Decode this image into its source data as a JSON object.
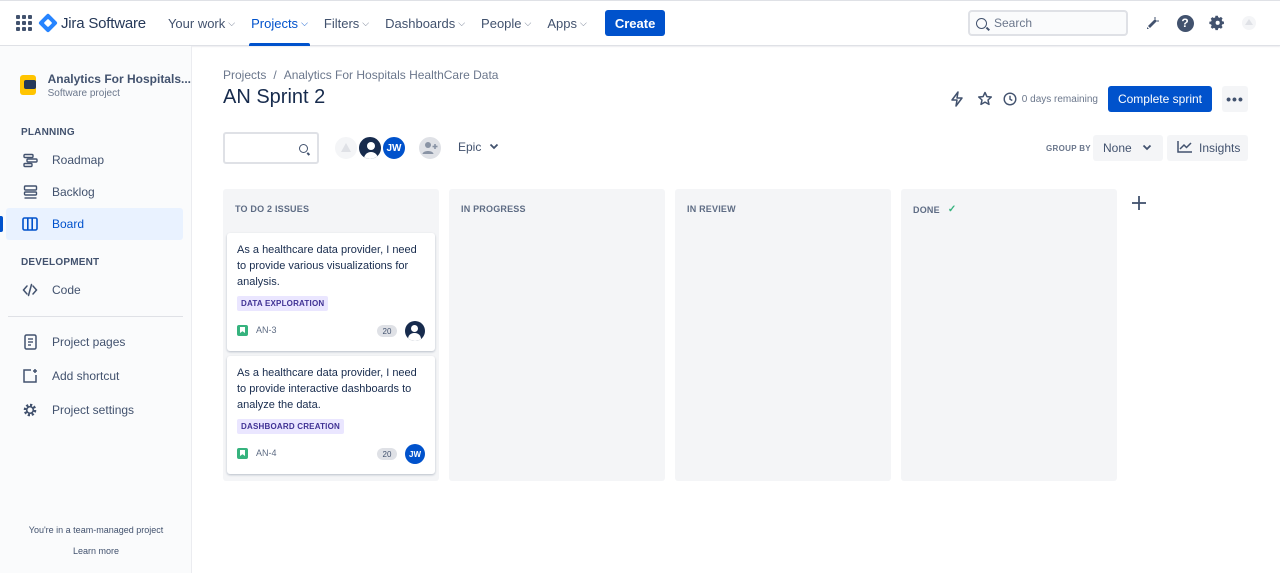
{
  "topnav": {
    "product_name": "Jira Software",
    "items": [
      {
        "label": "Your work",
        "active": false
      },
      {
        "label": "Projects",
        "active": true
      },
      {
        "label": "Filters",
        "active": false
      },
      {
        "label": "Dashboards",
        "active": false
      },
      {
        "label": "People",
        "active": false
      },
      {
        "label": "Apps",
        "active": false
      }
    ],
    "create_label": "Create",
    "search_placeholder": "Search"
  },
  "sidebar": {
    "project_name": "Analytics For Hospitals...",
    "project_type": "Software project",
    "planning_label": "PLANNING",
    "planning_items": [
      {
        "label": "Roadmap",
        "icon": "roadmap-icon"
      },
      {
        "label": "Backlog",
        "icon": "backlog-icon"
      },
      {
        "label": "Board",
        "icon": "board-icon",
        "active": true
      }
    ],
    "development_label": "DEVELOPMENT",
    "development_items": [
      {
        "label": "Code",
        "icon": "code-icon"
      }
    ],
    "other_items": [
      {
        "label": "Project pages",
        "icon": "page-icon"
      },
      {
        "label": "Add shortcut",
        "icon": "add-shortcut-icon"
      },
      {
        "label": "Project settings",
        "icon": "gear-icon"
      }
    ],
    "footer_text": "You're in a team-managed project",
    "learn_more": "Learn more"
  },
  "main": {
    "breadcrumb": [
      "Projects",
      "/",
      "Analytics For Hospitals HealthCare Data"
    ],
    "title": "AN Sprint 2",
    "days_remaining": "0 days remaining",
    "complete_sprint_label": "Complete sprint",
    "more_label": "•••",
    "epic_filter_label": "Epic",
    "group_by_label": "GROUP BY",
    "group_by_value": "None",
    "insights_label": "Insights",
    "avatars": [
      "JW"
    ]
  },
  "board": {
    "columns": [
      {
        "title": "TO DO 2 ISSUES",
        "cards": [
          {
            "text": "As a healthcare data provider, I need to provide various visualizations for analysis.",
            "epic": "DATA EXPLORATION",
            "key": "AN-3",
            "points": "20",
            "assignee": ""
          },
          {
            "text": "As a healthcare data provider, I need to provide interactive dashboards to analyze the data.",
            "epic": "DASHBOARD CREATION",
            "key": "AN-4",
            "points": "20",
            "assignee": "JW"
          }
        ]
      },
      {
        "title": "IN PROGRESS",
        "cards": []
      },
      {
        "title": "IN REVIEW",
        "cards": []
      },
      {
        "title": "DONE",
        "done": true,
        "cards": []
      }
    ]
  },
  "colors": {
    "accent": "#0052cc",
    "epic_bg": "#eae6ff",
    "epic_text": "#403294",
    "story": "#36b37e",
    "column_bg": "#f4f5f7"
  }
}
